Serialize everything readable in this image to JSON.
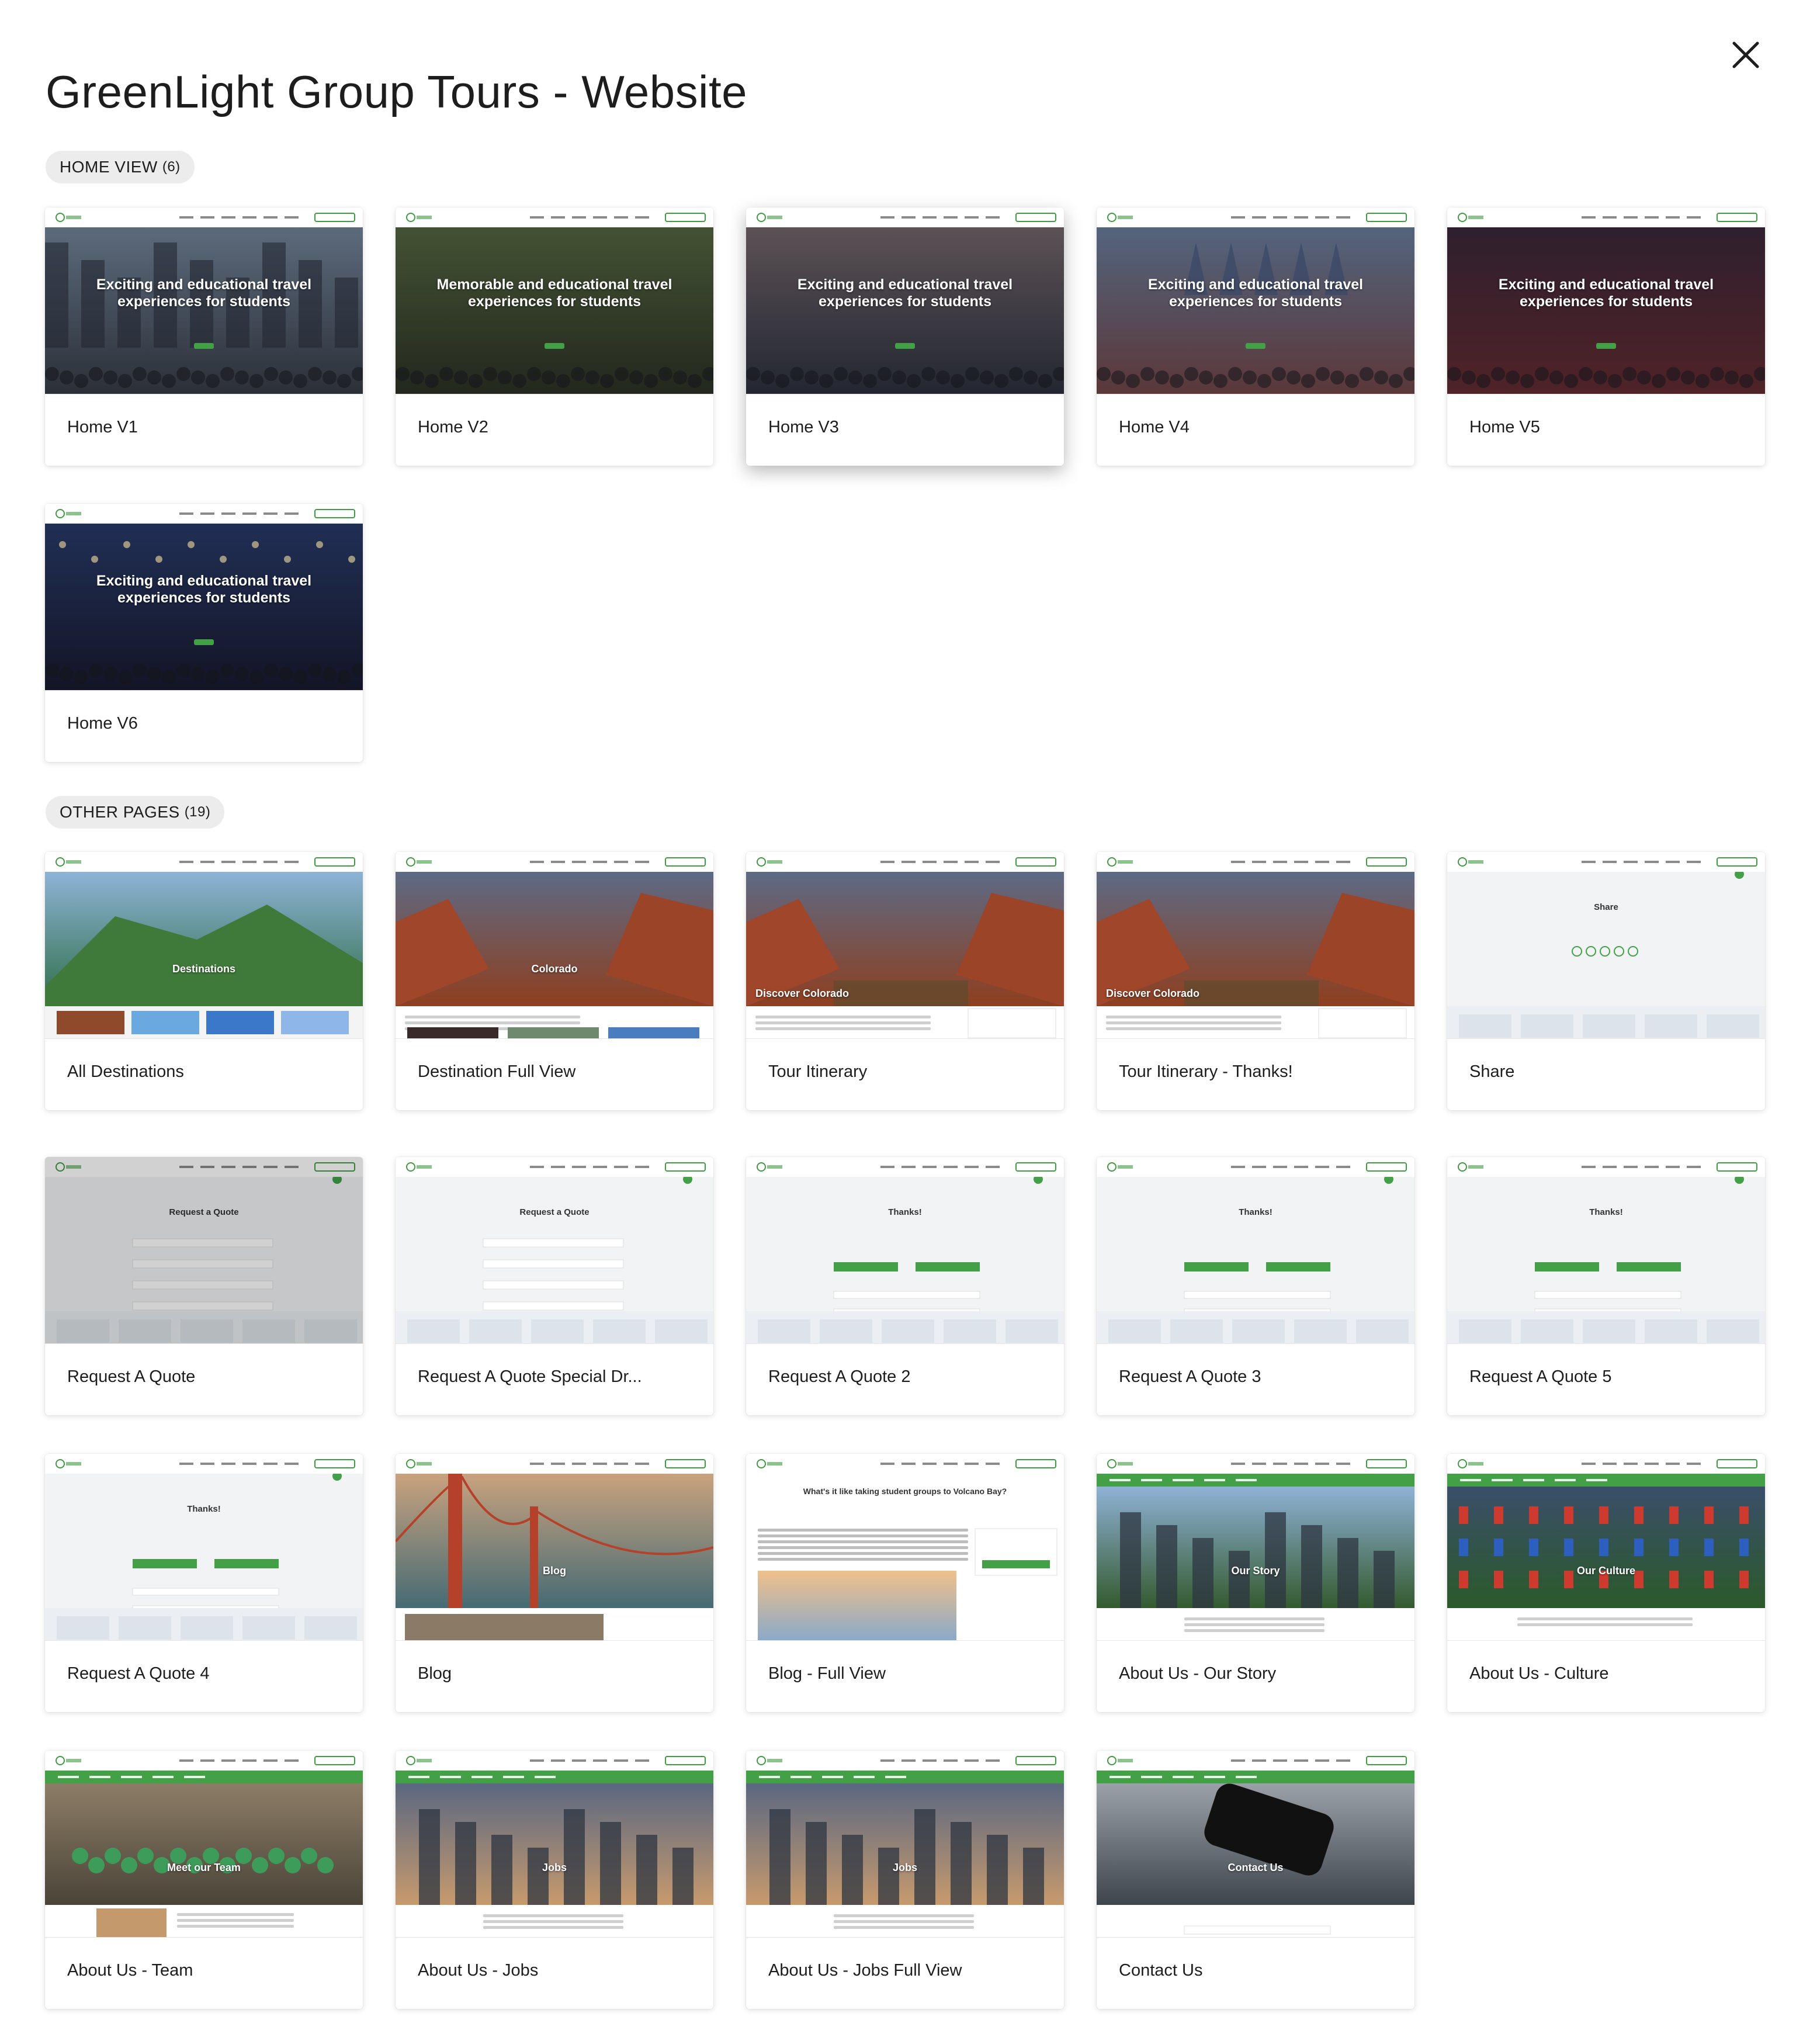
{
  "title": "GreenLight Group Tours - Website",
  "close_icon": "close-icon",
  "colors": {
    "brand_green": "#3f9b3f",
    "pill_bg": "#ececec"
  },
  "sections": [
    {
      "label": "HOME VIEW",
      "count": "(6)",
      "cards": [
        {
          "label": "Home V1",
          "hero": "Exciting and educational travel experiences for students"
        },
        {
          "label": "Home V2",
          "hero": "Memorable and educational travel experiences for students"
        },
        {
          "label": "Home V3",
          "hero": "Exciting and educational travel experiences for students"
        },
        {
          "label": "Home V4",
          "hero": "Exciting and educational travel experiences for students"
        },
        {
          "label": "Home V5",
          "hero": "Exciting and educational travel experiences for students"
        },
        {
          "label": "Home V6",
          "hero": "Exciting and educational travel experiences for students"
        }
      ]
    },
    {
      "label": "OTHER PAGES",
      "count": "(19)",
      "cards": [
        {
          "label": "All Destinations",
          "hero": "Destinations"
        },
        {
          "label": "Destination Full View",
          "hero": "Colorado"
        },
        {
          "label": "Tour Itinerary",
          "hero": "Discover Colorado"
        },
        {
          "label": "Tour Itinerary - Thanks!",
          "hero": "Discover Colorado"
        },
        {
          "label": "Share",
          "hero": "Share"
        },
        {
          "label": "Request A Quote",
          "hero": "Request a Quote"
        },
        {
          "label": "Request A Quote Special Dr...",
          "hero": "Request a Quote"
        },
        {
          "label": "Request A Quote 2",
          "hero": "Thanks!"
        },
        {
          "label": "Request A Quote 3",
          "hero": "Thanks!"
        },
        {
          "label": "Request A Quote 5",
          "hero": "Thanks!"
        },
        {
          "label": "Request A Quote 4",
          "hero": "Thanks!"
        },
        {
          "label": "Blog",
          "hero": "Blog"
        },
        {
          "label": "Blog - Full View",
          "hero": "What's it like taking student groups to Volcano Bay?"
        },
        {
          "label": "About Us - Our Story",
          "hero": "Our Story"
        },
        {
          "label": "About Us - Culture",
          "hero": "Our Culture"
        },
        {
          "label": "About Us - Team",
          "hero": "Meet our Team"
        },
        {
          "label": "About Us - Jobs",
          "hero": "Jobs"
        },
        {
          "label": "About Us - Jobs Full View",
          "hero": "Jobs"
        },
        {
          "label": "Contact Us",
          "hero": "Contact Us"
        }
      ]
    }
  ]
}
